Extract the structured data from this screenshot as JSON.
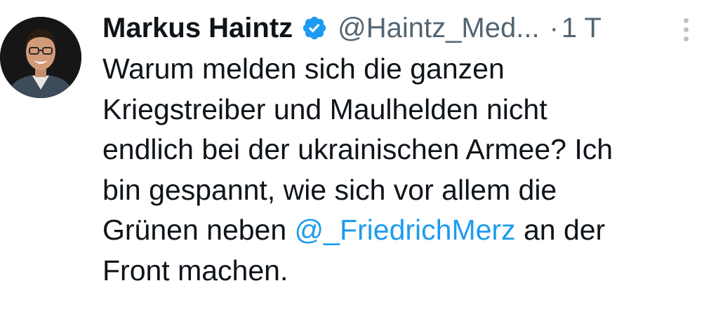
{
  "tweet": {
    "author": {
      "display_name": "Markus Haintz",
      "handle": "@Haintz_Med...",
      "verified": true,
      "verified_icon": "verified-badge-icon",
      "avatar_icon": "profile-photo"
    },
    "separator": "·",
    "time": "1 T",
    "more_icon": "more-options-icon",
    "body": {
      "line1": "Warum melden sich die ganzen",
      "line2": "Kriegstreiber und Maulhelden nicht",
      "line3": "endlich bei der ukrainischen Armee? Ich",
      "line4": "bin gespannt, wie sich vor allem die",
      "line5_before": "Grünen neben ",
      "line5_mention": "@_FriedrichMerz",
      "line5_after": " an der",
      "line6": "Front machen."
    }
  },
  "colors": {
    "text": "#0f1419",
    "secondary": "#536471",
    "accent": "#1d9bf0",
    "background": "#ffffff"
  }
}
